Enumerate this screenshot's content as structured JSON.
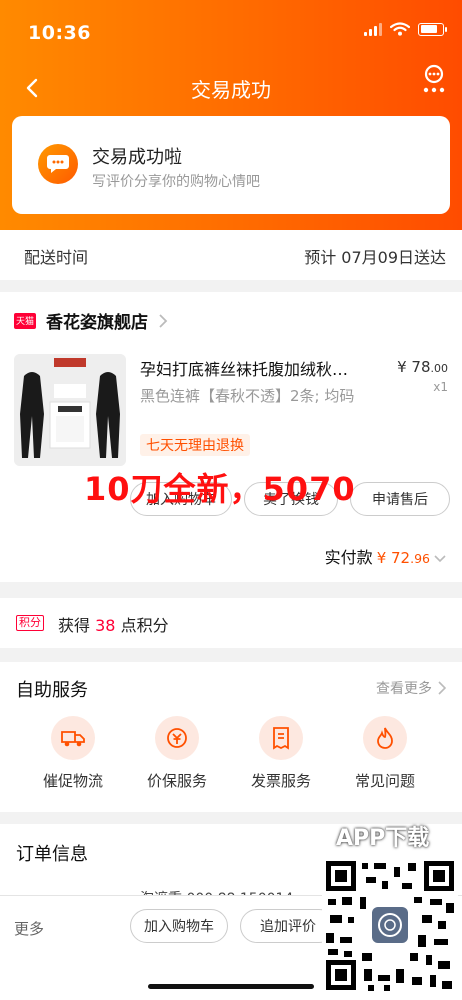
{
  "status_bar": {
    "time": "10:36"
  },
  "nav": {
    "title": "交易成功"
  },
  "success_card": {
    "title": "交易成功啦",
    "subtitle": "写评价分享你的购物心情吧"
  },
  "delivery": {
    "label": "配送时间",
    "value": "预计 07月09日送达"
  },
  "store": {
    "badge": "天猫",
    "name": "香花姿旗舰店"
  },
  "product": {
    "title": "孕妇打底裤丝袜托腹加绒秋…",
    "price_symbol": "¥",
    "price_main": "78",
    "price_decimal": ".00",
    "quantity": "x1",
    "variant": "黑色连裤【春秋不透】2条; 均码",
    "return_tag": "七天无理由退换"
  },
  "actions": {
    "add_cart": "加入购物车",
    "resell": "卖了换钱",
    "after_sale": "申请售后"
  },
  "overlay_text": {
    "watermark": "10刀全新，5070",
    "app_download": "APP下载"
  },
  "paid": {
    "label": "实付款",
    "symbol": "¥",
    "amount": "72",
    "decimal": ".96"
  },
  "points": {
    "tag": "积分",
    "prefix": "获得",
    "value": "38",
    "suffix": "点积分"
  },
  "self_service": {
    "title": "自助服务",
    "more": "查看更多",
    "items": [
      {
        "label": "催促物流",
        "icon": "truck-icon"
      },
      {
        "label": "价保服务",
        "icon": "price-protect-icon"
      },
      {
        "label": "发票服务",
        "icon": "invoice-icon"
      },
      {
        "label": "常见问题",
        "icon": "fire-icon"
      }
    ]
  },
  "order_info": {
    "title": "订单信息",
    "partial": "淘遮重 000   88 150014"
  },
  "bottom_bar": {
    "more": "更多",
    "add_cart": "加入购物车",
    "review": "追加评价"
  },
  "colors": {
    "accent": "#ff5000",
    "header_gradient_start": "#ff8a00",
    "header_gradient_end": "#ff4c00",
    "tmall": "#ff0036"
  }
}
